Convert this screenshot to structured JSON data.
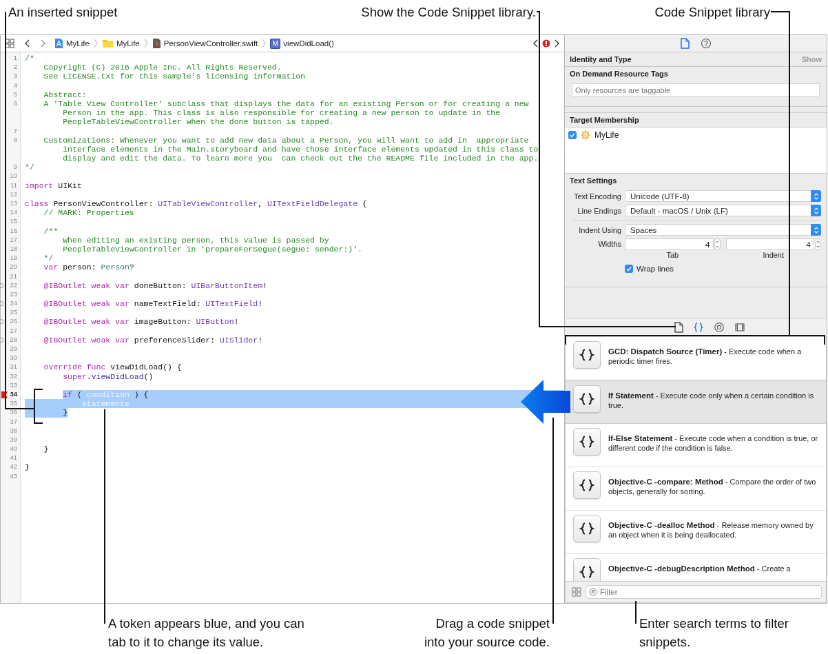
{
  "jump_bar": {
    "path": [
      {
        "kind": "project",
        "label": "MyLife"
      },
      {
        "kind": "folder",
        "label": "MyLife"
      },
      {
        "kind": "swift",
        "label": "PersonViewController.swift"
      },
      {
        "kind": "method",
        "badge": "M",
        "label": "viewDidLoad()"
      }
    ],
    "issue": {
      "kind": "error"
    }
  },
  "editor": {
    "lines": [
      {
        "number": "1",
        "code": [
          {
            "kind": "comment",
            "text": "/*"
          }
        ]
      },
      {
        "number": "2",
        "code": [
          {
            "kind": "comment",
            "text": "    Copyright (C) 2016 Apple Inc. All Rights Reserved."
          }
        ]
      },
      {
        "number": "3",
        "code": [
          {
            "kind": "comment",
            "text": "    See LICENSE.txt for this sample’s licensing information"
          }
        ]
      },
      {
        "number": "4"
      },
      {
        "number": "5",
        "code": [
          {
            "kind": "comment",
            "text": "    Abstract:"
          }
        ]
      },
      {
        "number": "6",
        "code": [
          {
            "kind": "comment",
            "text": "    A 'Table View Controller' subclass that displays the data for an existing Person or for creating a new"
          }
        ],
        "wrapped": [
          [
            {
              "kind": "comment",
              "text": "        Person in the app. This class is also responsible for creating a new person to update in the"
            }
          ],
          [
            {
              "kind": "comment",
              "text": "        PeopleTableViewController when the done button is tapped."
            }
          ]
        ]
      },
      {
        "number": "7"
      },
      {
        "number": "8",
        "code": [
          {
            "kind": "comment",
            "text": "    Customizations: Whenever you want to add new data about a Person, you will want to add in  appropriate"
          }
        ],
        "wrapped": [
          [
            {
              "kind": "comment",
              "text": "        interface elements in the Main.storyboard and have those interface elements updated in this class to"
            }
          ],
          [
            {
              "kind": "comment",
              "text": "        display and edit the data. To learn more you  can check out the the README file included in the app."
            }
          ]
        ]
      },
      {
        "number": "9",
        "code": [
          {
            "kind": "comment",
            "text": "*/"
          }
        ]
      },
      {
        "number": "10"
      },
      {
        "number": "11",
        "code": [
          {
            "kind": "keyword",
            "text": "import"
          },
          {
            "kind": "plain",
            "text": " UIKit"
          }
        ]
      },
      {
        "number": "12"
      },
      {
        "number": "13",
        "code": [
          {
            "kind": "keyword",
            "text": "class"
          },
          {
            "kind": "plain",
            "text": " PersonViewController: "
          },
          {
            "kind": "type",
            "text": "UITableViewController"
          },
          {
            "kind": "plain",
            "text": ", "
          },
          {
            "kind": "type",
            "text": "UITextFieldDelegate"
          },
          {
            "kind": "plain",
            "text": " {"
          }
        ]
      },
      {
        "number": "14",
        "code": [
          {
            "kind": "comment",
            "text": "    // MARK: Properties"
          }
        ]
      },
      {
        "number": "15"
      },
      {
        "number": "16",
        "code": [
          {
            "kind": "comment",
            "text": "    /**"
          }
        ]
      },
      {
        "number": "17",
        "code": [
          {
            "kind": "comment",
            "text": "        When editing an existing person, this value is passed by"
          }
        ]
      },
      {
        "number": "18",
        "code": [
          {
            "kind": "comment",
            "text": "        PeopleTableViewController in 'prepareForSegue(segue: sender:)'."
          }
        ]
      },
      {
        "number": "19",
        "code": [
          {
            "kind": "comment",
            "text": "    */"
          }
        ]
      },
      {
        "number": "20",
        "code": [
          {
            "kind": "keyword",
            "text": "    var"
          },
          {
            "kind": "plain",
            "text": " person: "
          },
          {
            "kind": "usertype",
            "text": "Person"
          },
          {
            "kind": "plain",
            "text": "?"
          }
        ]
      },
      {
        "number": "21"
      },
      {
        "number": "22",
        "gutter": {
          "kind": "outlet"
        },
        "code": [
          {
            "kind": "keyword",
            "text": "    @IBOutlet weak var"
          },
          {
            "kind": "plain",
            "text": " doneButton: "
          },
          {
            "kind": "type",
            "text": "UIBarButtonItem"
          },
          {
            "kind": "plain",
            "text": "!"
          }
        ]
      },
      {
        "number": "23"
      },
      {
        "number": "24",
        "gutter": {
          "kind": "outlet"
        },
        "code": [
          {
            "kind": "keyword",
            "text": "    @IBOutlet weak var"
          },
          {
            "kind": "plain",
            "text": " nameTextField: "
          },
          {
            "kind": "type",
            "text": "UITextField"
          },
          {
            "kind": "plain",
            "text": "!"
          }
        ]
      },
      {
        "number": "25"
      },
      {
        "number": "26",
        "gutter": {
          "kind": "outlet"
        },
        "code": [
          {
            "kind": "keyword",
            "text": "    @IBOutlet weak var"
          },
          {
            "kind": "plain",
            "text": " imageButton: "
          },
          {
            "kind": "type",
            "text": "UIButton"
          },
          {
            "kind": "plain",
            "text": "!"
          }
        ]
      },
      {
        "number": "27"
      },
      {
        "number": "28",
        "gutter": {
          "kind": "outlet"
        },
        "code": [
          {
            "kind": "keyword",
            "text": "    @IBOutlet weak var"
          },
          {
            "kind": "plain",
            "text": " preferenceSlider: "
          },
          {
            "kind": "type",
            "text": "UISlider"
          },
          {
            "kind": "plain",
            "text": "!"
          }
        ]
      },
      {
        "number": "29"
      },
      {
        "number": "30"
      },
      {
        "number": "31",
        "code": [
          {
            "kind": "keyword",
            "text": "    override func"
          },
          {
            "kind": "plain",
            "text": " viewDidLoad() {"
          }
        ]
      },
      {
        "number": "32",
        "code": [
          {
            "kind": "keyword",
            "text": "        super"
          },
          {
            "kind": "plain",
            "text": "."
          },
          {
            "kind": "method",
            "text": "viewDidLoad"
          },
          {
            "kind": "plain",
            "text": "()"
          }
        ]
      },
      {
        "number": "33"
      },
      {
        "number": "34",
        "gutter": {
          "kind": "error"
        },
        "selection": {
          "kind": "after_indent"
        },
        "code": [
          {
            "kind": "keyword",
            "text": "        if"
          },
          {
            "kind": "plain",
            "text": " ( "
          },
          {
            "kind": "token",
            "text": "condition"
          },
          {
            "kind": "plain",
            "text": " ) {"
          }
        ]
      },
      {
        "number": "35",
        "selection": {
          "kind": "row"
        },
        "code": [
          {
            "kind": "token",
            "text": "            statements"
          }
        ]
      },
      {
        "number": "36",
        "selection": {
          "kind": "text"
        },
        "code": [
          {
            "kind": "plain",
            "text": "        }"
          }
        ]
      },
      {
        "number": "37"
      },
      {
        "number": "38"
      },
      {
        "number": "39"
      },
      {
        "number": "40",
        "code": [
          {
            "kind": "plain",
            "text": "    }"
          }
        ]
      },
      {
        "number": "41"
      },
      {
        "number": "42",
        "code": [
          {
            "kind": "plain",
            "text": "}"
          }
        ]
      },
      {
        "number": "43"
      }
    ]
  },
  "inspector": {
    "tabs": [
      {
        "kind": "file",
        "selected": true
      },
      {
        "kind": "help",
        "selected": false
      }
    ],
    "identity": {
      "title": "Identity and Type",
      "action": "Show"
    },
    "resource_tags": {
      "title": "On Demand Resource Tags",
      "placeholder": "Only resources are taggable"
    },
    "target_membership": {
      "title": "Target Membership",
      "targets": [
        {
          "name": "MyLife",
          "checked": true
        }
      ]
    },
    "text_settings": {
      "title": "Text Settings",
      "selects": [
        {
          "label": "Text Encoding",
          "value": "Unicode (UTF-8)"
        },
        {
          "label": "Line Endings",
          "value": "Default - macOS / Unix (LF)"
        },
        {
          "label": "Indent Using",
          "value": "Spaces"
        }
      ],
      "widths": {
        "label": "Widths",
        "fields": [
          {
            "value": "4",
            "caption": "Tab"
          },
          {
            "value": "4",
            "caption": "Indent"
          }
        ]
      },
      "wrap_lines": {
        "label": "Wrap lines",
        "checked": true
      }
    }
  },
  "library": {
    "tabs": [
      {
        "kind": "file",
        "selected": false
      },
      {
        "kind": "snippet",
        "selected": true
      },
      {
        "kind": "object",
        "selected": false
      },
      {
        "kind": "media",
        "selected": false
      }
    ],
    "items": [
      {
        "title": "GCD: Dispatch Source (Timer)",
        "description": " - Execute code when a periodic timer fires.",
        "selected": false
      },
      {
        "title": "If Statement",
        "description": " - Execute code only when a certain condition is true.",
        "selected": true
      },
      {
        "title": "If-Else Statement",
        "description": " - Execute code when a condition is true, or different code if the condition is false.",
        "selected": false
      },
      {
        "title": "Objective-C -compare: Method",
        "description": " - Compare the order of two objects, generally for sorting.",
        "selected": false
      },
      {
        "title": "Objective-C -dealloc Method",
        "description": " - Release memory owned by an object when it is being deallocated.",
        "selected": false
      },
      {
        "title": "Objective-C -debugDescription Method",
        "description": " - Create a",
        "selected": false
      }
    ],
    "filter": {
      "placeholder": "Filter"
    }
  },
  "callouts": [
    {
      "text": "An inserted snippet"
    },
    {
      "text": "Show the Code Snippet library."
    },
    {
      "text": "Code Snippet library"
    },
    {
      "text": "A token appears blue, and you can tab to it to change its value."
    },
    {
      "text": "Drag a code snippet into your source code."
    },
    {
      "text": "Enter search terms to filter snippets."
    }
  ]
}
